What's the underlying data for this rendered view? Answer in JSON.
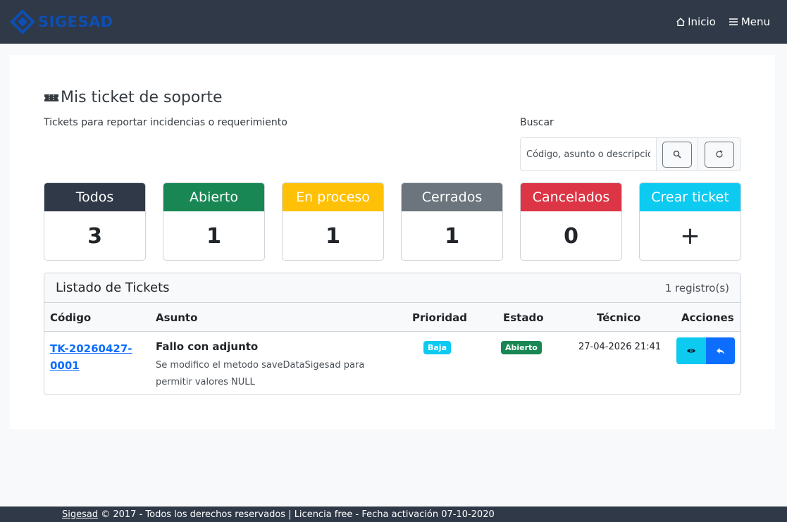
{
  "navbar": {
    "brand": "SIGESAD",
    "home_label": "Inicio",
    "menu_label": "Menu"
  },
  "page": {
    "title": "Mis ticket de soporte",
    "subtitle": "Tickets para reportar incidencias o requerimiento"
  },
  "search": {
    "label": "Buscar",
    "placeholder": "Código, asunto o descripción"
  },
  "stats": [
    {
      "label": "Todos",
      "value": "3",
      "color": "#2f3947"
    },
    {
      "label": "Abierto",
      "value": "1",
      "color": "#198754"
    },
    {
      "label": "En proceso",
      "value": "1",
      "color": "#ffc107"
    },
    {
      "label": "Cerrados",
      "value": "1",
      "color": "#6c757d"
    },
    {
      "label": "Cancelados",
      "value": "0",
      "color": "#dc3545"
    },
    {
      "label": "Crear ticket",
      "value": "+",
      "color": "#0dcaf0"
    }
  ],
  "table": {
    "title": "Listado de Tickets",
    "count": "1 registro(s)",
    "columns": [
      "Código",
      "Asunto",
      "Prioridad",
      "Estado",
      "Técnico",
      "Acciones"
    ],
    "rows": [
      {
        "code_line1": "TK-20260427-",
        "code_line2": "0001",
        "subject": "Fallo con adjunto",
        "description": "Se modifico el metodo saveDataSigesad para permitir valores NULL",
        "priority": "Baja",
        "status": "Abierto",
        "date": "27-04-2026 21:41"
      }
    ]
  },
  "footer": {
    "link": "Sigesad",
    "text": " © 2017 - Todos los derechos reservados | Licencia free - Fecha activación 07-10-2020"
  }
}
